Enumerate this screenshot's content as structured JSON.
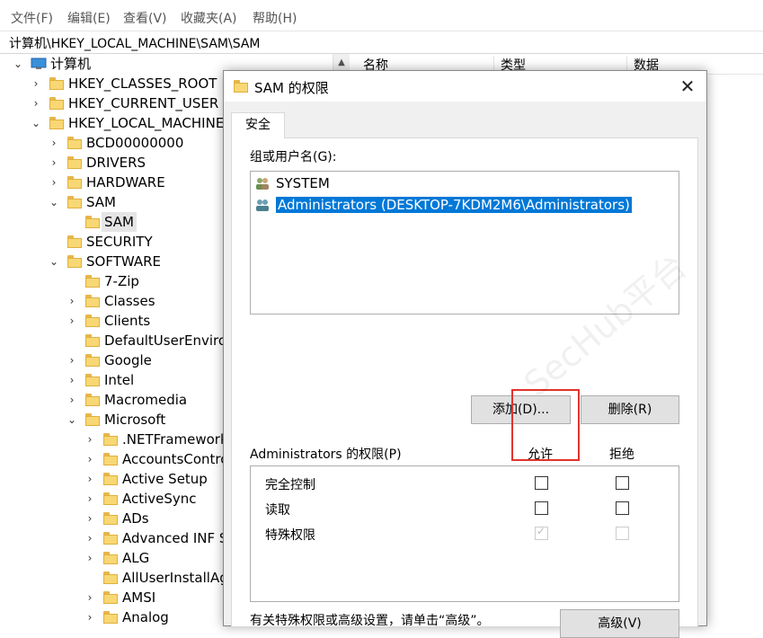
{
  "menu": [
    "文件(F)",
    "编辑(E)",
    "查看(V)",
    "收藏夹(A)",
    "帮助(H)"
  ],
  "address": "计算机\\HKEY_LOCAL_MACHINE\\SAM\\SAM",
  "list_headers": [
    "名称",
    "类型",
    "数据"
  ],
  "tree": {
    "root": "计算机",
    "hives": [
      "HKEY_CLASSES_ROOT",
      "HKEY_CURRENT_USER",
      "HKEY_LOCAL_MACHINE"
    ],
    "hklm_children": [
      "BCD00000000",
      "DRIVERS",
      "HARDWARE",
      "SAM",
      "SECURITY",
      "SOFTWARE"
    ],
    "sam_child": "SAM",
    "software_children": [
      "7-Zip",
      "Classes",
      "Clients",
      "DefaultUserEnviro",
      "Google",
      "Intel",
      "Macromedia",
      "Microsoft"
    ],
    "microsoft_children": [
      ".NETFramework",
      "AccountsContro",
      "Active Setup",
      "ActiveSync",
      "ADs",
      "Advanced INF S",
      "ALG",
      "AllUserInstallAg",
      "AMSI",
      "Analog"
    ]
  },
  "dialog": {
    "title": "SAM 的权限",
    "close": "✕",
    "tab": "安全",
    "group_label": "组或用户名(G):",
    "users": [
      "SYSTEM",
      "Administrators (DESKTOP-7KDM2M6\\Administrators)"
    ],
    "add_button": "添加(D)...",
    "remove_button": "删除(R)",
    "perm_label": "Administrators 的权限(P)",
    "allow_header": "允许",
    "deny_header": "拒绝",
    "permissions": [
      {
        "name": "完全控制",
        "allow": false,
        "deny": false
      },
      {
        "name": "读取",
        "allow": false,
        "deny": false
      },
      {
        "name": "特殊权限",
        "allow": true,
        "deny": false
      }
    ],
    "advanced_text": "有关特殊权限或高级设置，请单击“高级”。",
    "advanced_button": "高级(V)",
    "watermark": "SecHub平台"
  },
  "colors": {
    "selection": "#0078d7",
    "highlight_box": "#e2332b",
    "folder": "#f8d775"
  }
}
